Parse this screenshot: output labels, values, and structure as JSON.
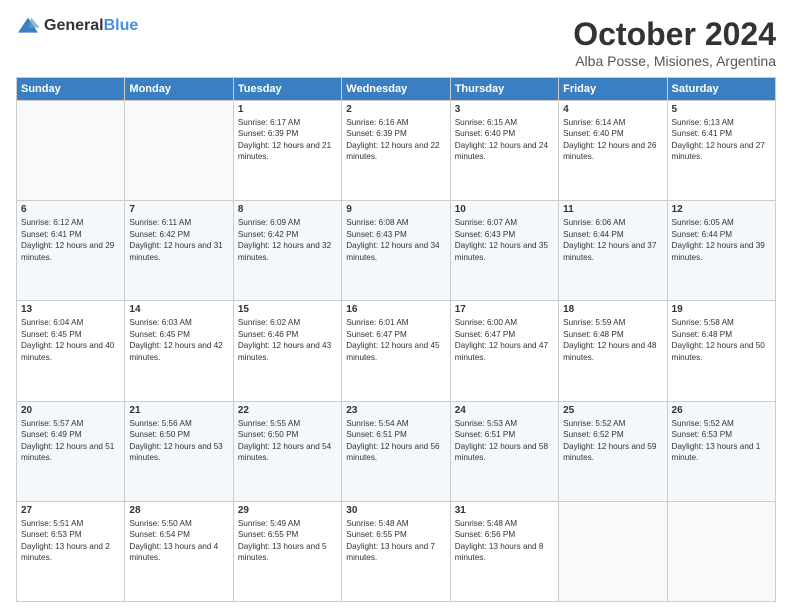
{
  "logo": {
    "general": "General",
    "blue": "Blue"
  },
  "header": {
    "month": "October 2024",
    "location": "Alba Posse, Misiones, Argentina"
  },
  "weekdays": [
    "Sunday",
    "Monday",
    "Tuesday",
    "Wednesday",
    "Thursday",
    "Friday",
    "Saturday"
  ],
  "weeks": [
    [
      {
        "day": "",
        "sunrise": "",
        "sunset": "",
        "daylight": ""
      },
      {
        "day": "",
        "sunrise": "",
        "sunset": "",
        "daylight": ""
      },
      {
        "day": "1",
        "sunrise": "Sunrise: 6:17 AM",
        "sunset": "Sunset: 6:39 PM",
        "daylight": "Daylight: 12 hours and 21 minutes."
      },
      {
        "day": "2",
        "sunrise": "Sunrise: 6:16 AM",
        "sunset": "Sunset: 6:39 PM",
        "daylight": "Daylight: 12 hours and 22 minutes."
      },
      {
        "day": "3",
        "sunrise": "Sunrise: 6:15 AM",
        "sunset": "Sunset: 6:40 PM",
        "daylight": "Daylight: 12 hours and 24 minutes."
      },
      {
        "day": "4",
        "sunrise": "Sunrise: 6:14 AM",
        "sunset": "Sunset: 6:40 PM",
        "daylight": "Daylight: 12 hours and 26 minutes."
      },
      {
        "day": "5",
        "sunrise": "Sunrise: 6:13 AM",
        "sunset": "Sunset: 6:41 PM",
        "daylight": "Daylight: 12 hours and 27 minutes."
      }
    ],
    [
      {
        "day": "6",
        "sunrise": "Sunrise: 6:12 AM",
        "sunset": "Sunset: 6:41 PM",
        "daylight": "Daylight: 12 hours and 29 minutes."
      },
      {
        "day": "7",
        "sunrise": "Sunrise: 6:11 AM",
        "sunset": "Sunset: 6:42 PM",
        "daylight": "Daylight: 12 hours and 31 minutes."
      },
      {
        "day": "8",
        "sunrise": "Sunrise: 6:09 AM",
        "sunset": "Sunset: 6:42 PM",
        "daylight": "Daylight: 12 hours and 32 minutes."
      },
      {
        "day": "9",
        "sunrise": "Sunrise: 6:08 AM",
        "sunset": "Sunset: 6:43 PM",
        "daylight": "Daylight: 12 hours and 34 minutes."
      },
      {
        "day": "10",
        "sunrise": "Sunrise: 6:07 AM",
        "sunset": "Sunset: 6:43 PM",
        "daylight": "Daylight: 12 hours and 35 minutes."
      },
      {
        "day": "11",
        "sunrise": "Sunrise: 6:06 AM",
        "sunset": "Sunset: 6:44 PM",
        "daylight": "Daylight: 12 hours and 37 minutes."
      },
      {
        "day": "12",
        "sunrise": "Sunrise: 6:05 AM",
        "sunset": "Sunset: 6:44 PM",
        "daylight": "Daylight: 12 hours and 39 minutes."
      }
    ],
    [
      {
        "day": "13",
        "sunrise": "Sunrise: 6:04 AM",
        "sunset": "Sunset: 6:45 PM",
        "daylight": "Daylight: 12 hours and 40 minutes."
      },
      {
        "day": "14",
        "sunrise": "Sunrise: 6:03 AM",
        "sunset": "Sunset: 6:45 PM",
        "daylight": "Daylight: 12 hours and 42 minutes."
      },
      {
        "day": "15",
        "sunrise": "Sunrise: 6:02 AM",
        "sunset": "Sunset: 6:46 PM",
        "daylight": "Daylight: 12 hours and 43 minutes."
      },
      {
        "day": "16",
        "sunrise": "Sunrise: 6:01 AM",
        "sunset": "Sunset: 6:47 PM",
        "daylight": "Daylight: 12 hours and 45 minutes."
      },
      {
        "day": "17",
        "sunrise": "Sunrise: 6:00 AM",
        "sunset": "Sunset: 6:47 PM",
        "daylight": "Daylight: 12 hours and 47 minutes."
      },
      {
        "day": "18",
        "sunrise": "Sunrise: 5:59 AM",
        "sunset": "Sunset: 6:48 PM",
        "daylight": "Daylight: 12 hours and 48 minutes."
      },
      {
        "day": "19",
        "sunrise": "Sunrise: 5:58 AM",
        "sunset": "Sunset: 6:48 PM",
        "daylight": "Daylight: 12 hours and 50 minutes."
      }
    ],
    [
      {
        "day": "20",
        "sunrise": "Sunrise: 5:57 AM",
        "sunset": "Sunset: 6:49 PM",
        "daylight": "Daylight: 12 hours and 51 minutes."
      },
      {
        "day": "21",
        "sunrise": "Sunrise: 5:56 AM",
        "sunset": "Sunset: 6:50 PM",
        "daylight": "Daylight: 12 hours and 53 minutes."
      },
      {
        "day": "22",
        "sunrise": "Sunrise: 5:55 AM",
        "sunset": "Sunset: 6:50 PM",
        "daylight": "Daylight: 12 hours and 54 minutes."
      },
      {
        "day": "23",
        "sunrise": "Sunrise: 5:54 AM",
        "sunset": "Sunset: 6:51 PM",
        "daylight": "Daylight: 12 hours and 56 minutes."
      },
      {
        "day": "24",
        "sunrise": "Sunrise: 5:53 AM",
        "sunset": "Sunset: 6:51 PM",
        "daylight": "Daylight: 12 hours and 58 minutes."
      },
      {
        "day": "25",
        "sunrise": "Sunrise: 5:52 AM",
        "sunset": "Sunset: 6:52 PM",
        "daylight": "Daylight: 12 hours and 59 minutes."
      },
      {
        "day": "26",
        "sunrise": "Sunrise: 5:52 AM",
        "sunset": "Sunset: 6:53 PM",
        "daylight": "Daylight: 13 hours and 1 minute."
      }
    ],
    [
      {
        "day": "27",
        "sunrise": "Sunrise: 5:51 AM",
        "sunset": "Sunset: 6:53 PM",
        "daylight": "Daylight: 13 hours and 2 minutes."
      },
      {
        "day": "28",
        "sunrise": "Sunrise: 5:50 AM",
        "sunset": "Sunset: 6:54 PM",
        "daylight": "Daylight: 13 hours and 4 minutes."
      },
      {
        "day": "29",
        "sunrise": "Sunrise: 5:49 AM",
        "sunset": "Sunset: 6:55 PM",
        "daylight": "Daylight: 13 hours and 5 minutes."
      },
      {
        "day": "30",
        "sunrise": "Sunrise: 5:48 AM",
        "sunset": "Sunset: 6:55 PM",
        "daylight": "Daylight: 13 hours and 7 minutes."
      },
      {
        "day": "31",
        "sunrise": "Sunrise: 5:48 AM",
        "sunset": "Sunset: 6:56 PM",
        "daylight": "Daylight: 13 hours and 8 minutes."
      },
      {
        "day": "",
        "sunrise": "",
        "sunset": "",
        "daylight": ""
      },
      {
        "day": "",
        "sunrise": "",
        "sunset": "",
        "daylight": ""
      }
    ]
  ]
}
